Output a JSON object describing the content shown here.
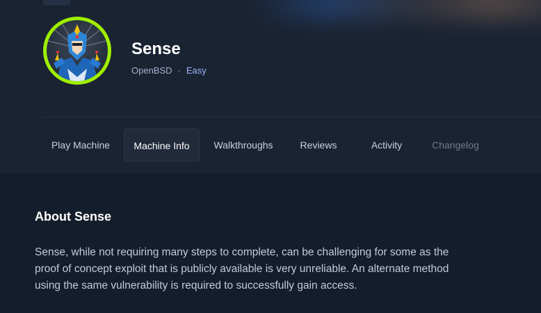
{
  "machine": {
    "name": "Sense",
    "os": "OpenBSD",
    "separator": "·",
    "difficulty": "Easy"
  },
  "tabs": [
    {
      "label": "Play Machine",
      "state": "normal"
    },
    {
      "label": "Machine Info",
      "state": "active"
    },
    {
      "label": "Walkthroughs",
      "state": "normal"
    },
    {
      "label": "Reviews",
      "state": "normal"
    },
    {
      "label": "Activity",
      "state": "normal"
    },
    {
      "label": "Changelog",
      "state": "disabled"
    }
  ],
  "about": {
    "title": "About Sense",
    "text": "Sense, while not requiring many steps to complete, can be challenging for some as the proof of concept exploit that is publicly available is very unreliable. An alternate method using the same vulnerability is required to successfully gain access."
  },
  "colors": {
    "background": "#141d2b",
    "header": "#1a2332",
    "avatar_ring": "#9fef00",
    "difficulty": "#9fb6ff"
  },
  "icons": {
    "avatar": "machine-avatar-armored-hero"
  }
}
